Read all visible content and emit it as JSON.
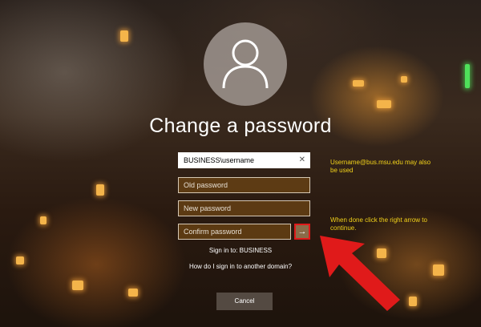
{
  "title": "Change a password",
  "fields": {
    "username_value": "BUSINESS\\username",
    "old_placeholder": "Old password",
    "new_placeholder": "New password",
    "confirm_placeholder": "Confirm password"
  },
  "submit_glyph": "→",
  "signin_to": "Sign in to: BUSINESS",
  "other_domain_link": "How do I sign in to another domain?",
  "cancel_label": "Cancel",
  "annotations": {
    "username_note": "Username@bus.msu.edu may also be used",
    "submit_note": "When done click the right arrow to continue."
  },
  "colors": {
    "annotation_text": "#f2d21a",
    "highlight": "#e01a1a"
  },
  "icons": [
    "user-avatar-icon",
    "clear-icon",
    "arrow-right-icon",
    "red-pointer-arrow-icon"
  ]
}
